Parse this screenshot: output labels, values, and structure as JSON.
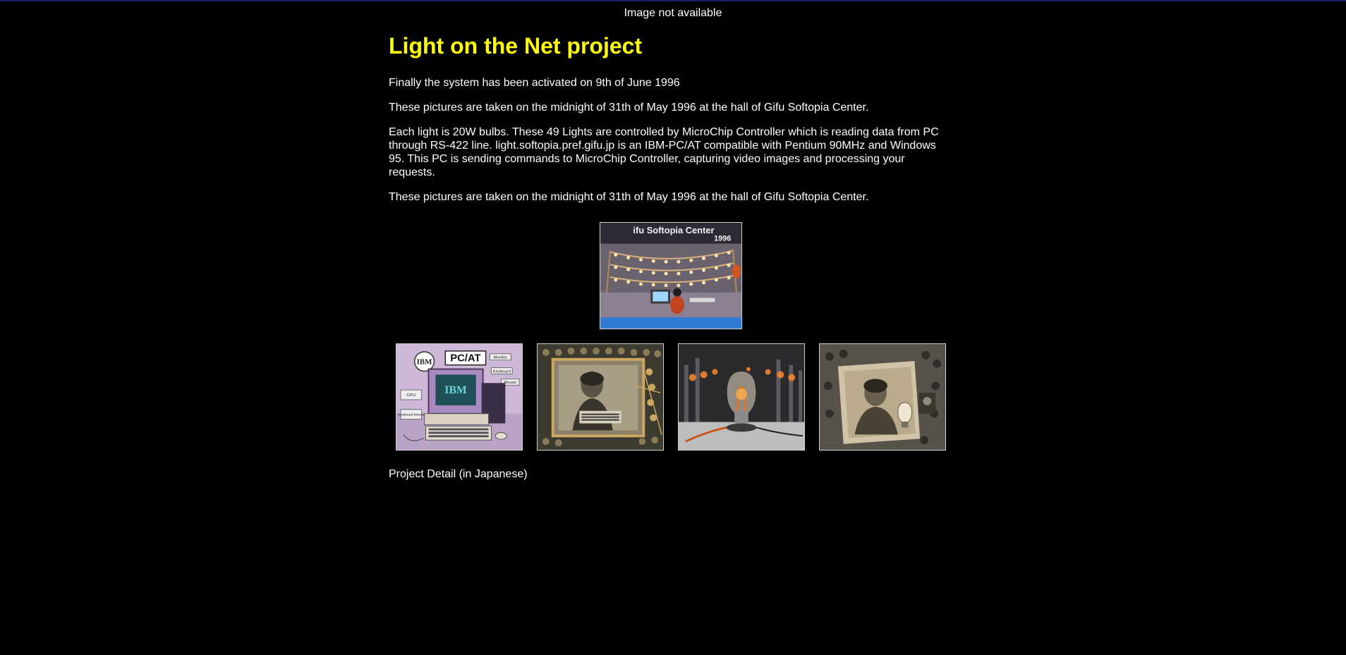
{
  "banner_text": "Image not available",
  "title": "Light on the Net project",
  "paragraphs": [
    "Finally the system has been activated on 9th of June 1996",
    "These pictures are taken on the midnight of 31th of May 1996 at the hall of Gifu Softopia Center.",
    "Each light is 20W bulbs. These 49 Lights are controlled by MicroChip Controller which is reading data from PC through RS-422 line. light.softopia.pref.gifu.jp is an IBM-PC/AT compatible with Pentium 90MHz and Windows 95. This PC is sending commands to MicroChip Controller, capturing video images and processing your requests.",
    "These pictures are taken on the midnight of 31th of May 1996 at the hall of Gifu Softopia Center."
  ],
  "images": {
    "main": {
      "sign_text": "ifu Softopia Center",
      "year_text": "1996"
    },
    "pc": {
      "brand": "IBM",
      "model": "PC/AT",
      "screen_text": "IBM",
      "labels": [
        "Monitor",
        "Keyboard",
        "Mouse",
        "CPU",
        "Keyboard Mouse"
      ]
    }
  },
  "footer_link": "Project Detail (in Japanese)",
  "colors": {
    "background": "#000000",
    "title": "#ffff00",
    "text": "#ffffff"
  }
}
